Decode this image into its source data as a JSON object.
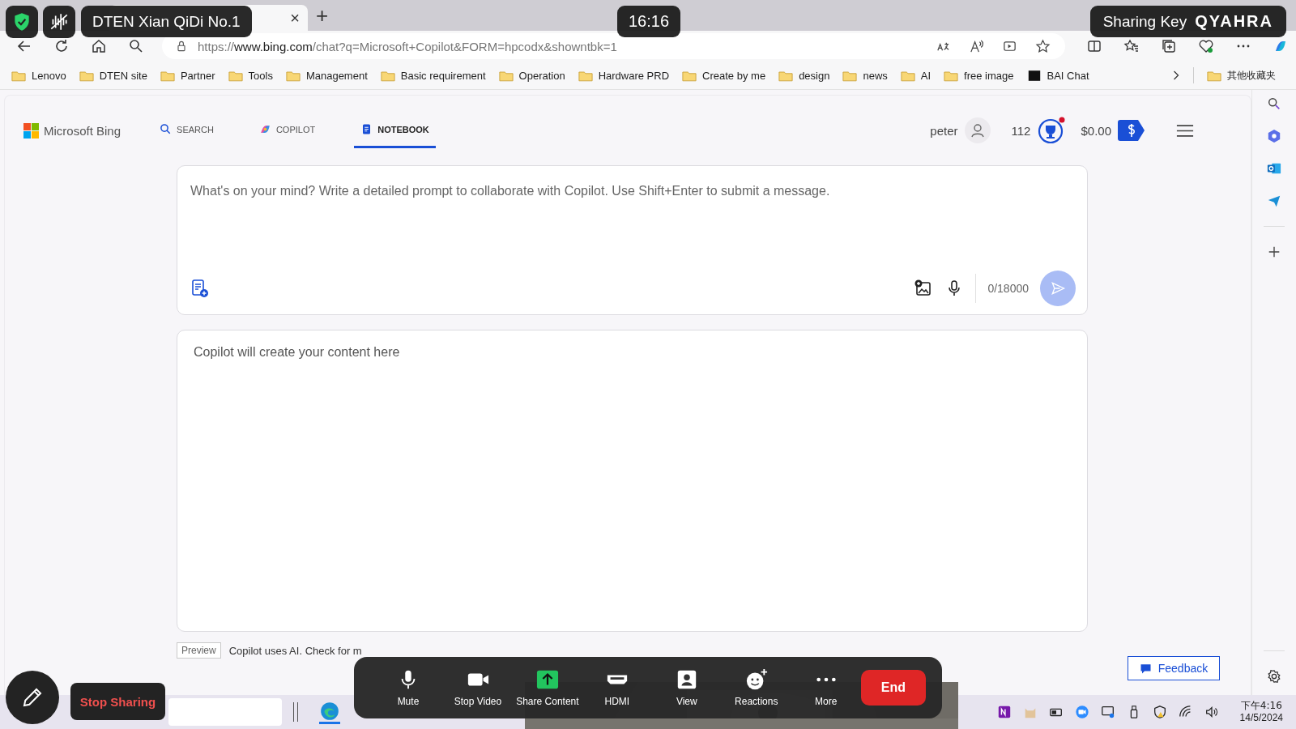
{
  "overlay": {
    "device_name": "DTEN Xian QiDi No.1",
    "clock": "16:16",
    "sharing_key_label": "Sharing Key",
    "sharing_key": "QYAHRA",
    "stop_sharing": "Stop Sharing",
    "meeting_controls": [
      {
        "label": "Mute",
        "kind": "mic"
      },
      {
        "label": "Stop Video",
        "kind": "video"
      },
      {
        "label": "Share Content",
        "kind": "share"
      },
      {
        "label": "HDMI",
        "kind": "hdmi"
      },
      {
        "label": "View",
        "kind": "view"
      },
      {
        "label": "Reactions",
        "kind": "reactions"
      },
      {
        "label": "More",
        "kind": "more"
      }
    ],
    "end_button": "End"
  },
  "browser": {
    "tab_close": "×",
    "new_tab": "+",
    "url_scheme": "https://",
    "url_host": "www.bing.com",
    "url_path": "/chat?q=Microsoft+Copilot&FORM=hpcodx&showntbk=1",
    "bookmarks": [
      {
        "label": "Lenovo",
        "kind": "folder"
      },
      {
        "label": "DTEN site",
        "kind": "folder"
      },
      {
        "label": "Partner",
        "kind": "folder"
      },
      {
        "label": "Tools",
        "kind": "folder"
      },
      {
        "label": "Management",
        "kind": "folder"
      },
      {
        "label": "Basic requirement",
        "kind": "folder"
      },
      {
        "label": "Operation",
        "kind": "folder"
      },
      {
        "label": "Hardware PRD",
        "kind": "folder"
      },
      {
        "label": "Create by me",
        "kind": "folder"
      },
      {
        "label": "design",
        "kind": "folder"
      },
      {
        "label": "news",
        "kind": "folder"
      },
      {
        "label": "AI",
        "kind": "folder"
      },
      {
        "label": "free image",
        "kind": "folder"
      },
      {
        "label": "BAI Chat",
        "kind": "site"
      }
    ],
    "other_bookmarks": "其他收藏夹"
  },
  "page": {
    "brand": "Microsoft Bing",
    "nav": [
      {
        "label": "SEARCH",
        "kind": "search",
        "selected": false
      },
      {
        "label": "COPILOT",
        "kind": "copilot",
        "selected": false
      },
      {
        "label": "NOTEBOOK",
        "kind": "notebook",
        "selected": true
      }
    ],
    "user": "peter",
    "points": "112",
    "balance": "$0.00",
    "prompt": {
      "placeholder": "What's on your mind? Write a detailed prompt to collaborate with Copilot. Use Shift+Enter to submit a message.",
      "counter": "0/18000"
    },
    "output_placeholder": "Copilot will create your content here",
    "preview_badge": "Preview",
    "disclaimer": "Copilot uses AI. Check for m",
    "feedback": "Feedback"
  },
  "taskbar": {
    "time": "下午4:16",
    "date": "14/5/2024"
  }
}
